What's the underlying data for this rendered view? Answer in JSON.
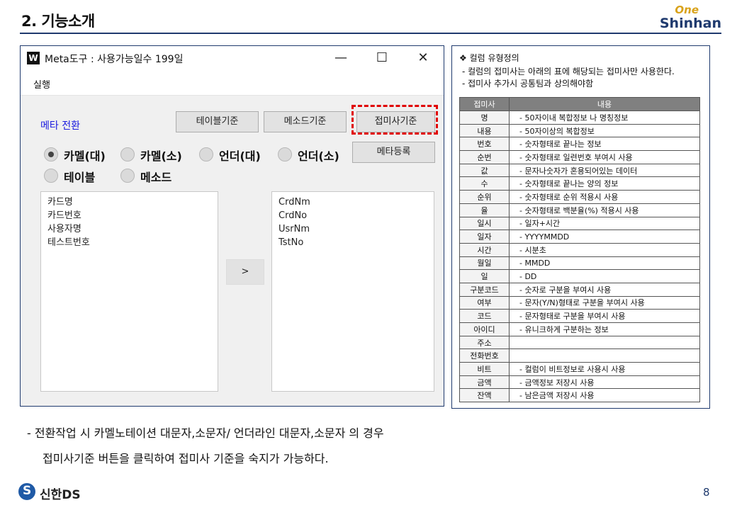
{
  "slide": {
    "title": "2. 기능소개",
    "brand_top": "One",
    "brand_bottom": "Shinhan",
    "footer_logo_text": "신한DS",
    "page_number": "8",
    "bottom_text_line1": "- 전환작업 시 카멜노테이션 대문자,소문자/ 언더라인 대문자,소문자 의 경우",
    "bottom_text_line2": "접미사기준 버튼을 클릭하여 접미사 기준을 숙지가 가능하다."
  },
  "window": {
    "icon_letter": "W",
    "title": "Meta도구 : 사용가능일수 199일",
    "controls": {
      "minimize": "—",
      "maximize": "☐",
      "close": "✕"
    },
    "menu": [
      "실행"
    ],
    "meta_label": "메타 전환",
    "buttons": {
      "table_basis": "테이블기준",
      "method_basis": "메소드기준",
      "suffix_basis": "접미사기준",
      "meta_register": "메타등록",
      "move_right": ">"
    },
    "radios": [
      {
        "label": "카멜(대)",
        "selected": true
      },
      {
        "label": "카멜(소)",
        "selected": false
      },
      {
        "label": "언더(대)",
        "selected": false
      },
      {
        "label": "언더(소)",
        "selected": false
      },
      {
        "label": "테이블",
        "selected": false
      },
      {
        "label": "메소드",
        "selected": false
      }
    ],
    "left_list": [
      "카드명",
      "카드번호",
      "사용자명",
      "테스트번호"
    ],
    "right_list": [
      "CrdNm",
      "CrdNo",
      "UsrNm",
      "TstNo"
    ]
  },
  "spec": {
    "heading": "❖  컬럼 유형정의",
    "note1": "- 컬럼의 접미사는 아래의 표에 해당되는 접미사만 사용한다.",
    "note2": "- 접미사 추가시 공통팀과 상의해야함",
    "headers": [
      "접미사",
      "내용"
    ],
    "rows": [
      [
        "명",
        "- 50자이내 복합정보 나 명칭정보"
      ],
      [
        "내용",
        "- 50자이상의 복합정보"
      ],
      [
        "번호",
        "- 숫자형태로 끝나는 정보"
      ],
      [
        "순번",
        "- 숫자형태로 일련번호 부여시 사용"
      ],
      [
        "값",
        "- 문자나숫자가 혼용되어있는 데이터"
      ],
      [
        "수",
        "- 숫자형태로 끝나는 양의 정보"
      ],
      [
        "순위",
        "- 숫자형태로 순위 적용시 사용"
      ],
      [
        "율",
        "- 숫자형태로 백분율(%) 적용시 사용"
      ],
      [
        "일시",
        "-  일자+시간"
      ],
      [
        "일자",
        "-  YYYYMMDD"
      ],
      [
        "시간",
        "-  시분초"
      ],
      [
        "월일",
        "-  MMDD"
      ],
      [
        "일",
        "-  DD"
      ],
      [
        "구분코드",
        "- 숫자로 구분을 부여시 사용"
      ],
      [
        "여부",
        "- 문자(Y/N)형태로 구분을 부여시 사용"
      ],
      [
        "코드",
        "- 문자형태로 구분을 부여시 사용"
      ],
      [
        "아이디",
        "- 유니크하게 구분하는 정보"
      ],
      [
        "주소",
        ""
      ],
      [
        "전화번호",
        ""
      ],
      [
        "비트",
        "- 컬럼이 비트정보로 사용시 사용"
      ],
      [
        "금액",
        "- 금액정보 저장시 사용"
      ],
      [
        "잔액",
        "- 남은금액 저장시 사용"
      ]
    ]
  },
  "colors": {
    "accent_navy": "#1f3a6e",
    "highlight_red": "#e00000",
    "meta_label_blue": "#1a1adf",
    "brand_gold": "#d9a21a"
  }
}
